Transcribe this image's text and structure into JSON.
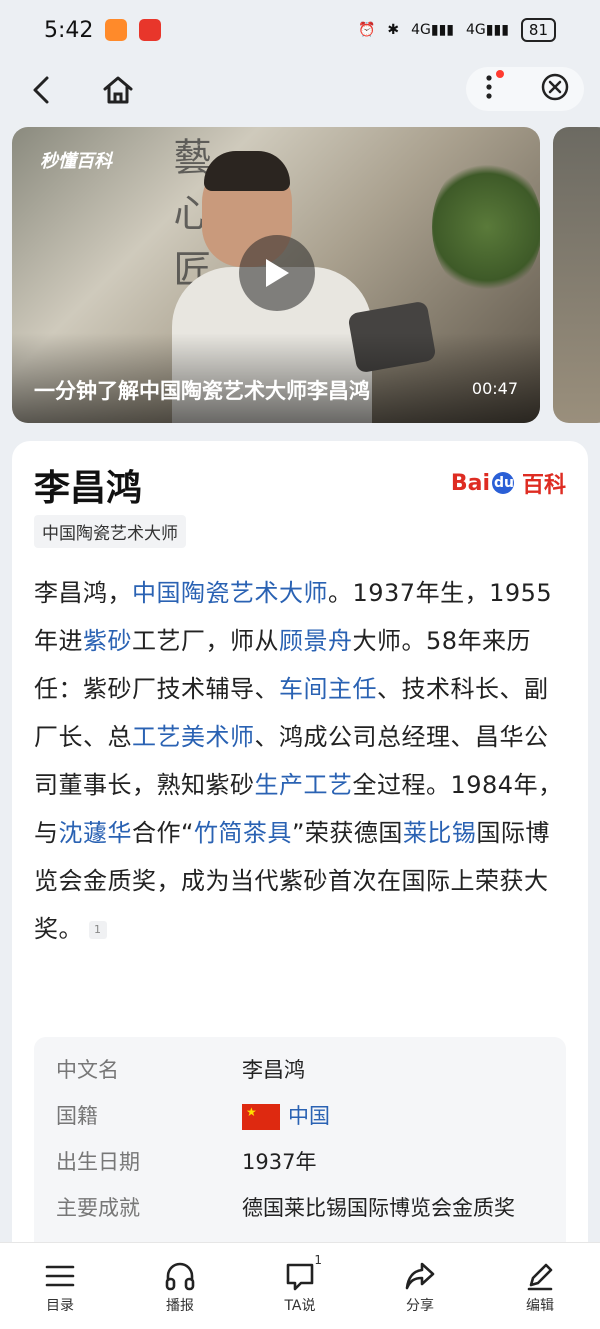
{
  "status_bar": {
    "time": "5:42",
    "battery": "81",
    "network1": "4G",
    "network2": "4G"
  },
  "video": {
    "brand": "秒懂百科",
    "title": "一分钟了解中国陶瓷艺术大师李昌鸿",
    "duration": "00:47"
  },
  "entry": {
    "title": "李昌鸿",
    "logo_text_bai": "Bai",
    "logo_text_du": "du",
    "logo_text_baike": "百科",
    "subtitle": "中国陶瓷艺术大师",
    "summary": {
      "p1": "李昌鸿，",
      "l1": "中国陶瓷艺术大师",
      "p2": "。1937年生，1955年进",
      "l2": "紫砂",
      "p3": "工艺厂，师从",
      "l3": "顾景舟",
      "p4": "大师。58年来历任：紫砂厂技术辅导、",
      "l4": "车间主任",
      "p5": "、技术科长、副厂长、总",
      "l5": "工艺美术师",
      "p6": "、鸿成公司总经理、昌华公司董事长，熟知紫砂",
      "l6": "生产工艺",
      "p7": "全过程。1984年，与",
      "l7": "沈蘧华",
      "p8": "合作“",
      "l8": "竹简茶具",
      "p9": "”荣获德国",
      "l9": "莱比锡",
      "p10": "国际博览会金质奖，成为当代紫砂首次在国际上荣获大奖。",
      "ref": "1"
    },
    "info": [
      {
        "key": "中文名",
        "value": "李昌鸿"
      },
      {
        "key": "国籍",
        "value": "中国"
      },
      {
        "key": "出生日期",
        "value": "1937年"
      },
      {
        "key": "主要成就",
        "value": "德国莱比锡国际博览会金质奖"
      }
    ]
  },
  "bottom_tabs": [
    {
      "label": "目录",
      "icon": "menu-icon"
    },
    {
      "label": "播报",
      "icon": "headphones-icon"
    },
    {
      "label": "TA说",
      "icon": "comment-icon",
      "count": "1"
    },
    {
      "label": "分享",
      "icon": "share-icon"
    },
    {
      "label": "编辑",
      "icon": "pen-icon"
    }
  ],
  "colors": {
    "link": "#2a62b3",
    "baidu_red": "#de2c22",
    "baidu_blue": "#2a5fd6"
  }
}
